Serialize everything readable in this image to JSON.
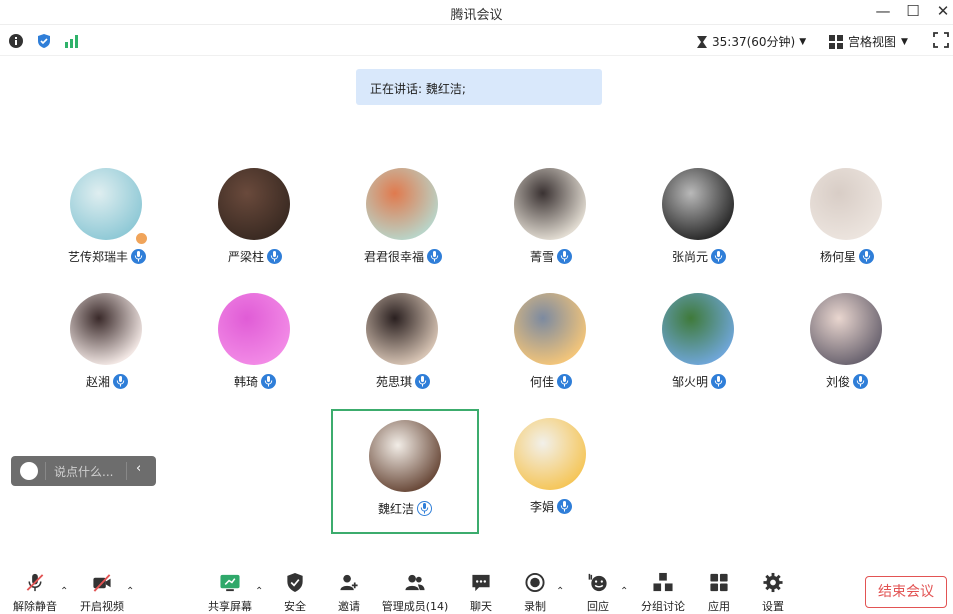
{
  "window": {
    "title": "腾讯会议"
  },
  "infobar": {
    "timer": "35:37(60分钟)",
    "view_label": "宫格视图"
  },
  "speaking": {
    "text": "正在讲话: 魏红洁;"
  },
  "participants": [
    {
      "name": "艺传郑瑞丰",
      "avatar_colors": [
        "#8fc9d6",
        "#dfeef0"
      ]
    },
    {
      "name": "严梁柱",
      "avatar_colors": [
        "#3a2a22",
        "#6a4a3c"
      ]
    },
    {
      "name": "君君很幸福",
      "avatar_colors": [
        "#b9d4c8",
        "#e07a4e"
      ]
    },
    {
      "name": "菁雪",
      "avatar_colors": [
        "#e2dcd2",
        "#3a3232"
      ]
    },
    {
      "name": "张尚元",
      "avatar_colors": [
        "#2a2a2a",
        "#b9b9b9"
      ]
    },
    {
      "name": "杨何星",
      "avatar_colors": [
        "#ece4de",
        "#d8cdc6"
      ]
    },
    {
      "name": "赵湘",
      "avatar_colors": [
        "#f2e7e4",
        "#3a2a2a"
      ]
    },
    {
      "name": "韩琦",
      "avatar_colors": [
        "#f28ae6",
        "#e05cd6"
      ]
    },
    {
      "name": "苑思琪",
      "avatar_colors": [
        "#d7c4b4",
        "#2a2020"
      ]
    },
    {
      "name": "何佳",
      "avatar_colors": [
        "#f3c57a",
        "#7c8aa0"
      ]
    },
    {
      "name": "邹火明",
      "avatar_colors": [
        "#6fa6d8",
        "#3f7a3a"
      ]
    },
    {
      "name": "刘俊",
      "avatar_colors": [
        "#6b6470",
        "#e9d6cf"
      ]
    },
    {
      "name": "魏红洁",
      "avatar_colors": [
        "#6a4a3a",
        "#f2ede7"
      ]
    },
    {
      "name": "李娟",
      "avatar_colors": [
        "#f5c65a",
        "#f2f0ea"
      ]
    }
  ],
  "chat": {
    "placeholder": "说点什么..."
  },
  "toolbar": {
    "unmute": "解除静音",
    "start_video": "开启视频",
    "share_screen": "共享屏幕",
    "security": "安全",
    "invite": "邀请",
    "manage_members": "管理成员(14)",
    "chat": "聊天",
    "record": "录制",
    "react": "回应",
    "breakout": "分组讨论",
    "apps": "应用",
    "settings": "设置",
    "end_meeting": "结束会议"
  },
  "colors": {
    "accent_blue": "#2f7ed8",
    "active_green": "#3cac6d",
    "end_red": "#e25353",
    "signal_green": "#2fb26a"
  }
}
